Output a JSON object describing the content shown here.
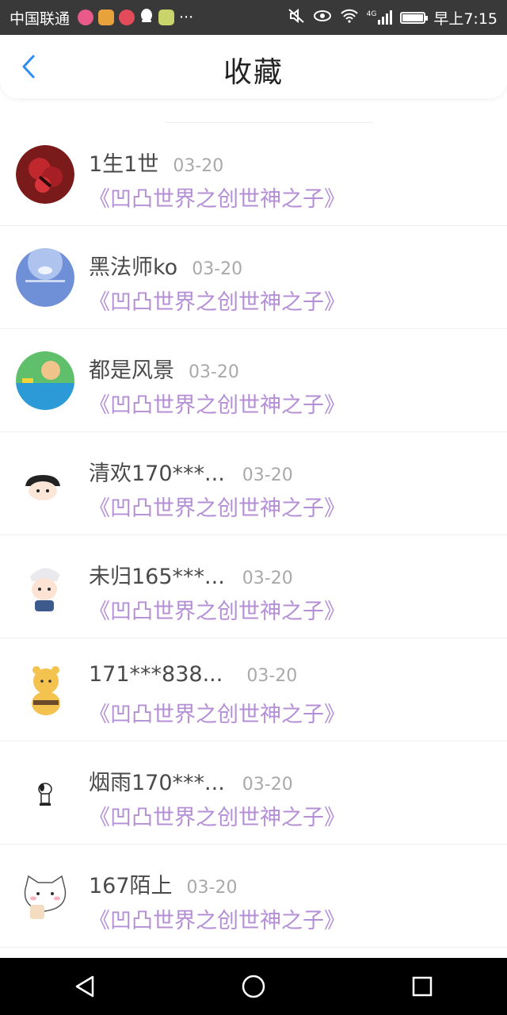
{
  "status_bar": {
    "carrier": "中国联通",
    "more": "···",
    "time": "早上7:15",
    "network": "4G"
  },
  "header": {
    "title": "收藏"
  },
  "items": [
    {
      "name": "1生1世",
      "date": "03-20",
      "title": "《凹凸世界之创世神之子》",
      "avatar": "red-flower-avatar"
    },
    {
      "name": "黑法师ko",
      "date": "03-20",
      "title": "《凹凸世界之创世神之子》",
      "avatar": "blue-sky-avatar"
    },
    {
      "name": "都是风景",
      "date": "03-20",
      "title": "《凹凸世界之创世神之子》",
      "avatar": "green-toy-avatar"
    },
    {
      "name": "清欢170***...",
      "date": "03-20",
      "title": "《凹凸世界之创世神之子》",
      "avatar": "boy-cartoon-avatar"
    },
    {
      "name": "未归165***...",
      "date": "03-20",
      "title": "《凹凸世界之创世神之子》",
      "avatar": "girl-cartoon-avatar"
    },
    {
      "name": "171***838...",
      "date": "03-20",
      "title": "《凹凸世界之创世神之子》",
      "avatar": "bear-avatar"
    },
    {
      "name": "烟雨170***...",
      "date": "03-20",
      "title": "《凹凸世界之创世神之子》",
      "avatar": "snoopy-avatar"
    },
    {
      "name": "167陌上",
      "date": "03-20",
      "title": "《凹凸世界之创世神之子》",
      "avatar": "cat-avatar"
    }
  ],
  "colors": {
    "link": "#b48fd6",
    "back_arrow": "#2d8df2",
    "status_bar": "#393939"
  }
}
